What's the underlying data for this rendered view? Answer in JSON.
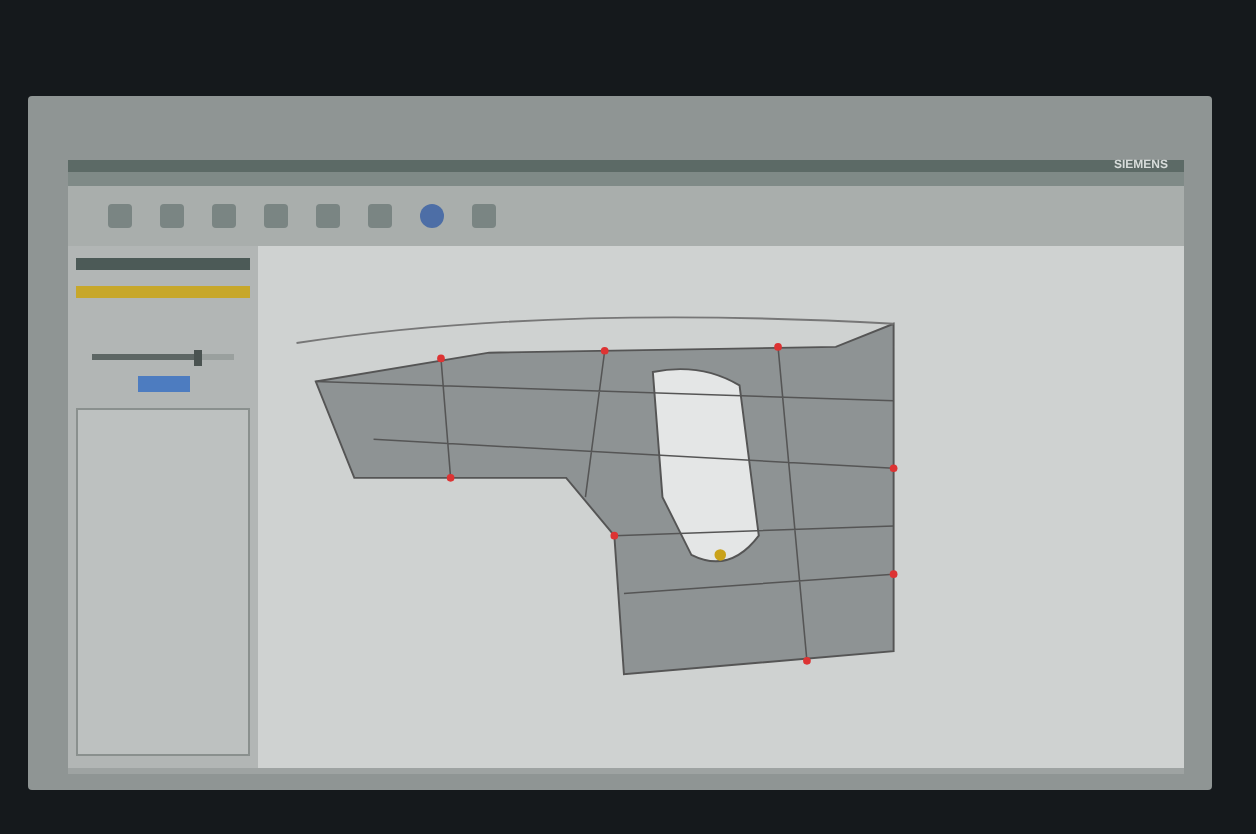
{
  "window": {
    "brand": "SIEMENS"
  },
  "panel": {
    "slider": {
      "level": 0.72
    }
  }
}
